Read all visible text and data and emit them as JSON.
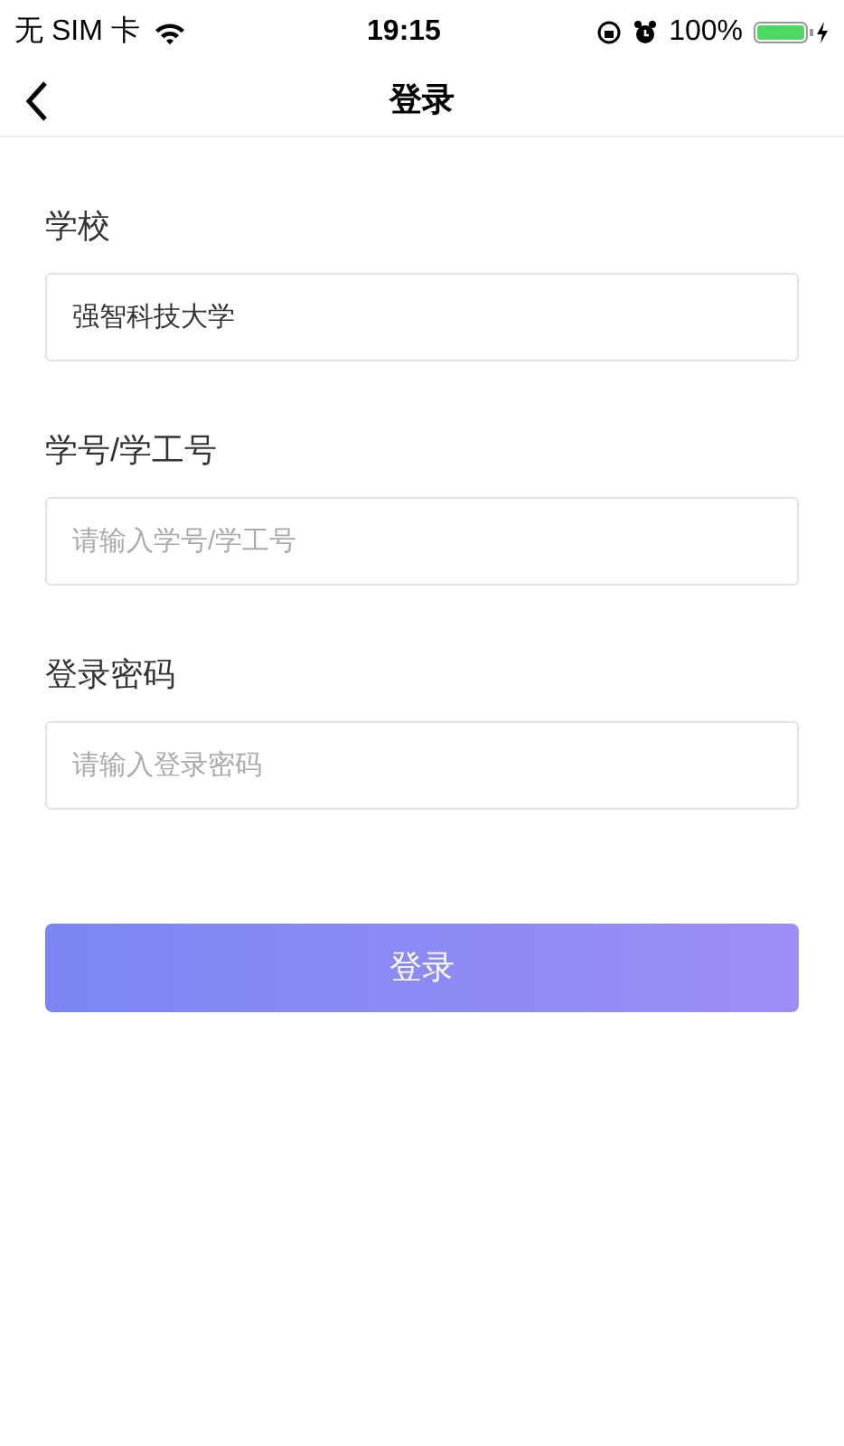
{
  "status_bar": {
    "carrier": "无 SIM 卡",
    "time": "19:15",
    "battery": "100%"
  },
  "nav_bar": {
    "title": "登录"
  },
  "fields": [
    {
      "label": "学校",
      "value": "强智科技大学"
    },
    {
      "label": "学号/学工号",
      "placeholder": "请输入学号/学工号"
    },
    {
      "label": "登录密码",
      "placeholder": "请输入登录密码"
    }
  ],
  "submit_button": "登录"
}
